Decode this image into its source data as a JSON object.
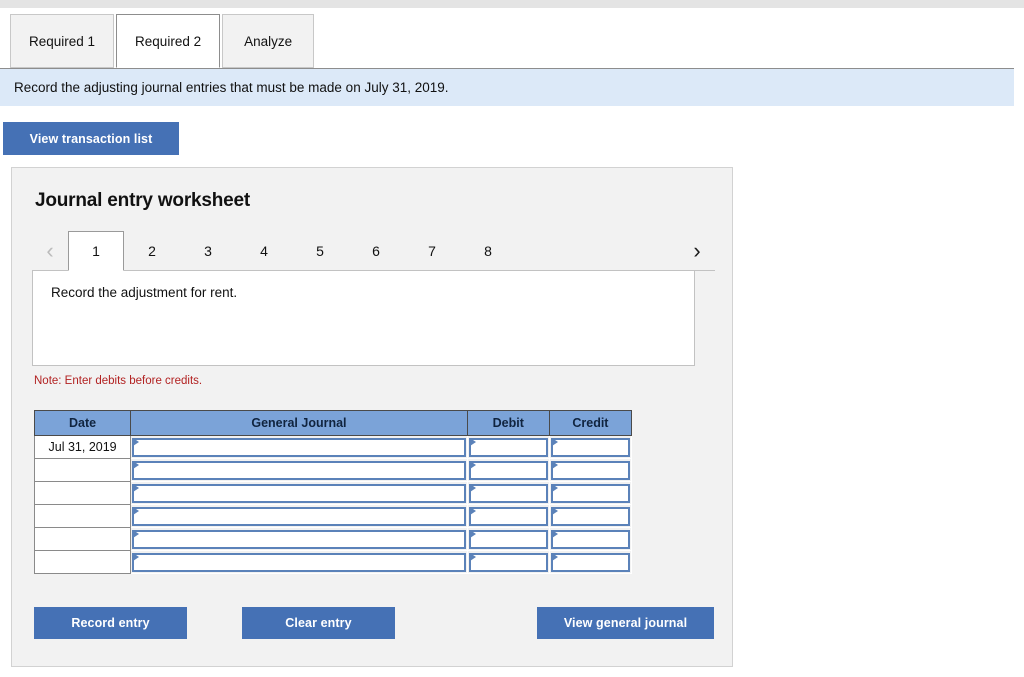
{
  "tabs": [
    {
      "label": "Required 1",
      "active": false
    },
    {
      "label": "Required 2",
      "active": true
    },
    {
      "label": "Analyze",
      "active": false
    }
  ],
  "banner": {
    "text": "Record the adjusting journal entries that must be made on July 31, 2019."
  },
  "toolbar": {
    "view_transaction_list_label": "View transaction list"
  },
  "worksheet": {
    "title": "Journal entry worksheet",
    "pager": {
      "prev_icon": "chevron-left-icon",
      "next_icon": "chevron-right-icon",
      "prev_glyph": "‹",
      "next_glyph": "›",
      "pages": [
        "1",
        "2",
        "3",
        "4",
        "5",
        "6",
        "7",
        "8"
      ],
      "active_page": "1"
    },
    "prompt": "Record the adjustment for rent.",
    "note": "Note: Enter debits before credits.",
    "table": {
      "headers": [
        "Date",
        "General Journal",
        "Debit",
        "Credit"
      ],
      "rows": [
        {
          "date": "Jul 31, 2019",
          "general_journal": "",
          "debit": "",
          "credit": ""
        },
        {
          "date": "",
          "general_journal": "",
          "debit": "",
          "credit": ""
        },
        {
          "date": "",
          "general_journal": "",
          "debit": "",
          "credit": ""
        },
        {
          "date": "",
          "general_journal": "",
          "debit": "",
          "credit": ""
        },
        {
          "date": "",
          "general_journal": "",
          "debit": "",
          "credit": ""
        },
        {
          "date": "",
          "general_journal": "",
          "debit": "",
          "credit": ""
        }
      ]
    },
    "actions": {
      "record_entry_label": "Record entry",
      "clear_entry_label": "Clear entry",
      "view_general_journal_label": "View general journal"
    }
  },
  "colors": {
    "accent_blue": "#4571b5",
    "header_blue": "#7ba3d8",
    "banner_blue": "#dce9f8",
    "panel_gray": "#f2f2f2",
    "note_red": "#b22222",
    "field_border": "#5b82b9"
  }
}
